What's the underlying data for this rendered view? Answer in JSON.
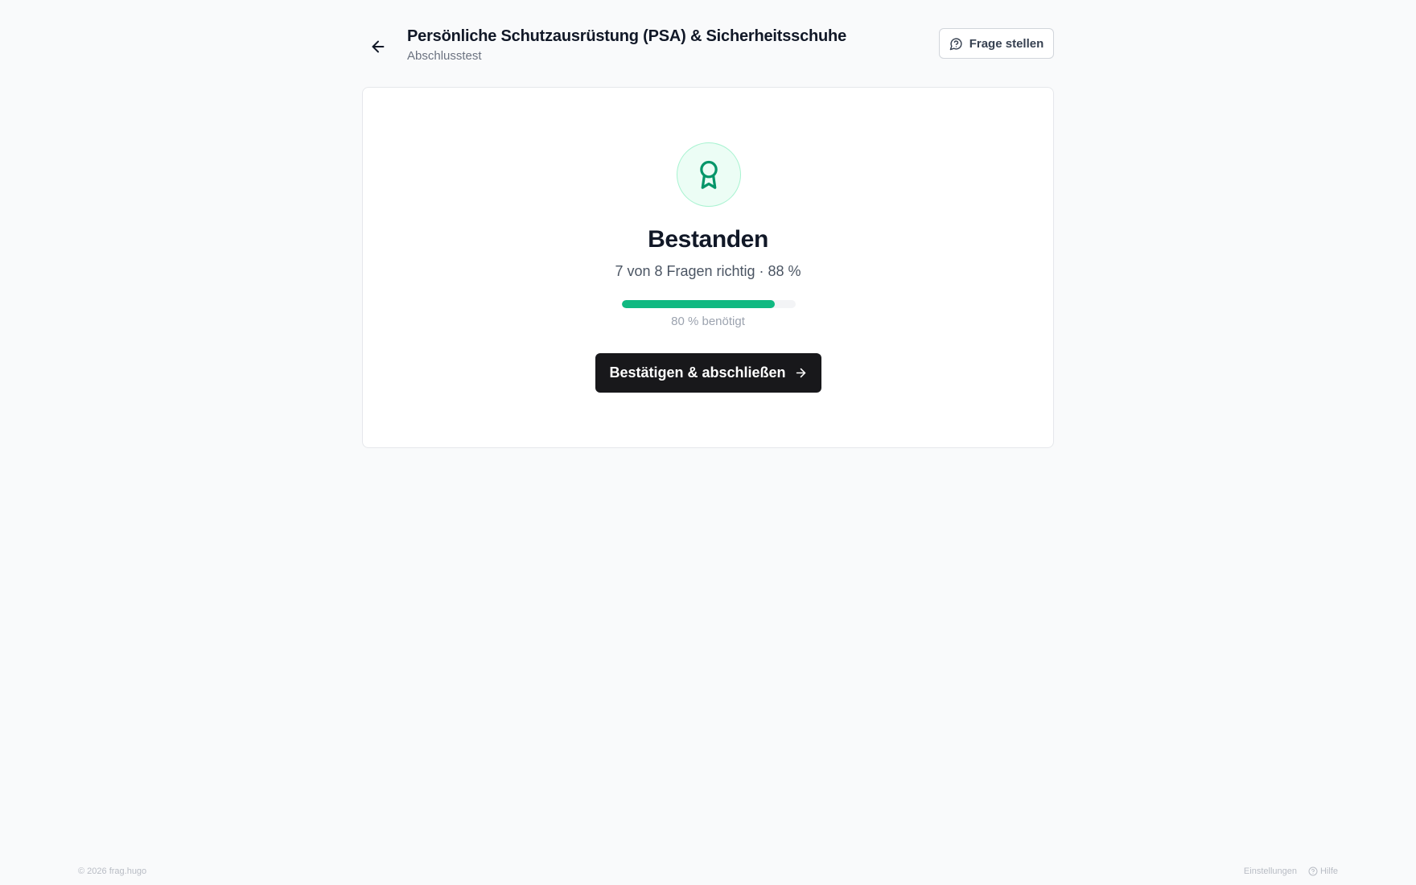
{
  "header": {
    "back_icon": "arrow-left-icon",
    "title": "Persönliche Schutzausrüstung (PSA) & Sicherheitsschuhe",
    "subtitle": "Abschlusstest",
    "ask_button": {
      "label": "Frage stellen",
      "icon": "message-question-icon"
    }
  },
  "result": {
    "icon": "award-icon",
    "title": "Bestanden",
    "summary": "7 von 8 Fragen richtig · 88 %",
    "score_percent": 88,
    "required_label": "80 % benötigt",
    "confirm_button": {
      "label": "Bestätigen & abschließen",
      "icon": "arrow-right-icon"
    }
  },
  "footer": {
    "copyright": "© 2026 frag.hugo",
    "settings_link": "Einstellungen",
    "help_link": "Hilfe",
    "help_icon": "help-circle-icon"
  },
  "colors": {
    "accent_green": "#10b981",
    "badge_icon": "#059669",
    "primary_button": "#18181b",
    "background": "#f9fafb"
  }
}
